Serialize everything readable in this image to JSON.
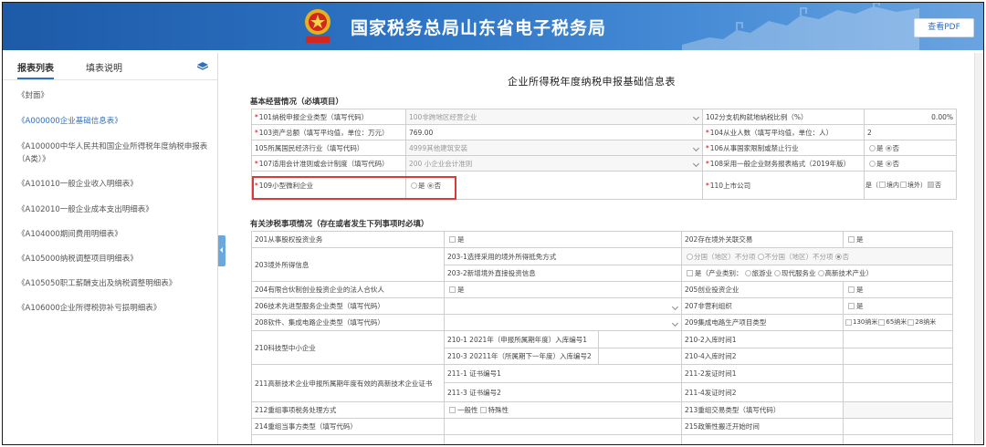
{
  "header": {
    "title": "国家税务总局山东省电子税务局",
    "pdf_button": "查看PDF",
    "colors": {
      "bar_start": "#1d5aa8",
      "bar_end": "#6aa4e0",
      "accent": "#2f6fc0",
      "highlight": "#d93a3a"
    }
  },
  "sidebar": {
    "tabs": [
      "报表列表",
      "填表说明"
    ],
    "items": [
      "《封面》",
      "《A000000企业基础信息表》",
      "《A100000中华人民共和国企业所得税年度纳税申报表（A类）》",
      "《A101010一般企业收入明细表》",
      "《A102010一般企业成本支出明细表》",
      "《A104000期间费用明细表》",
      "《A105000纳税调整项目明细表》",
      "《A105050职工薪酬支出及纳税调整明细表》",
      "《A106000企业所得税弥补亏损明细表》"
    ]
  },
  "main": {
    "title": "企业所得税年度纳税申报基础信息表",
    "section1_title": "基本经营情况（必填项目）",
    "section2_title": "有关涉税事项情况（存在或者发生下列事项时必填）",
    "basic": {
      "r101_label": "101纳税申报企业类型（填写代码）",
      "r101_value": "100非跨地区经营企业",
      "r102_label": "102分支机构就地纳税比例（%）",
      "r102_value": "0.00%",
      "r103_label": "103资产总额（填写平均值，单位：万元）",
      "r103_value": "769.00",
      "r104_label": "104从业人数（填写平均值，单位：人）",
      "r104_value": "2",
      "r105_label": "105所属国民经济行业（填写代码）",
      "r105_value": "4999其他建筑安装",
      "r106_label": "106从事国家限制或禁止行业",
      "r107_label": "107适用会计准则或会计制度（填写代码）",
      "r107_value": "200 小企业会计准则",
      "r108_label": "108采用一般企业财务报表格式（2019年版）",
      "r109_label": "109小型微利企业",
      "r110_label": "110上市公司",
      "yes": "是",
      "no": "否",
      "listed_prefix": "是（",
      "domestic": "境内",
      "overseas": "境外）",
      "required_mark": "*"
    },
    "tax": {
      "r201": "201从事股权投资业务",
      "r202": "202存在境外关联交易",
      "r203": "203境外所得信息",
      "r203_1": "203-1选择采用的境外所得抵免方式",
      "r203_1_opts": [
        "分国（地区）不分项",
        "不分国（地区）不分项",
        "否"
      ],
      "r203_2": "203-2新增境外直接投资信息",
      "r203_2_prefix": "是（产业类别：",
      "r203_2_opts": [
        "旅游业",
        "现代服务业",
        "高新技术产业）"
      ],
      "r204": "204有限合伙制创业投资企业的法人合伙人",
      "r205": "205创业投资企业",
      "r206": "206技术先进型服务企业类型（填写代码）",
      "r207": "207非营利组织",
      "r208": "208软件、集成电路企业类型（填写代码）",
      "r209": "209集成电路生产项目类型",
      "r209_opts": [
        "130纳米",
        "65纳米",
        "28纳米"
      ],
      "r210": "210科技型中小企业",
      "r210_1": "210-1  2021年（申报所属期年度）入库编号1",
      "r210_2": "210-2入库时间1",
      "r210_3": "210-3  20211年（所属期下一年度）入库编号2",
      "r210_4": "210-4入库时间2",
      "r211": "211高新技术企业申报所属期年度有效的高新技术企业证书",
      "r211_1": "211-1 证书编号1",
      "r211_2": "211-2发证时间1",
      "r211_3": "211-3 证书编号2",
      "r211_4": "211-4发证时间2",
      "r212": "212重组事项税务处理方式",
      "r212_opts": [
        "一般性",
        "特殊性"
      ],
      "r213": "213重组交易类型（填写代码）",
      "r214": "214重组当事方类型（填写代码）",
      "r215": "215政策性搬迁开始时间",
      "yes": "是"
    }
  }
}
